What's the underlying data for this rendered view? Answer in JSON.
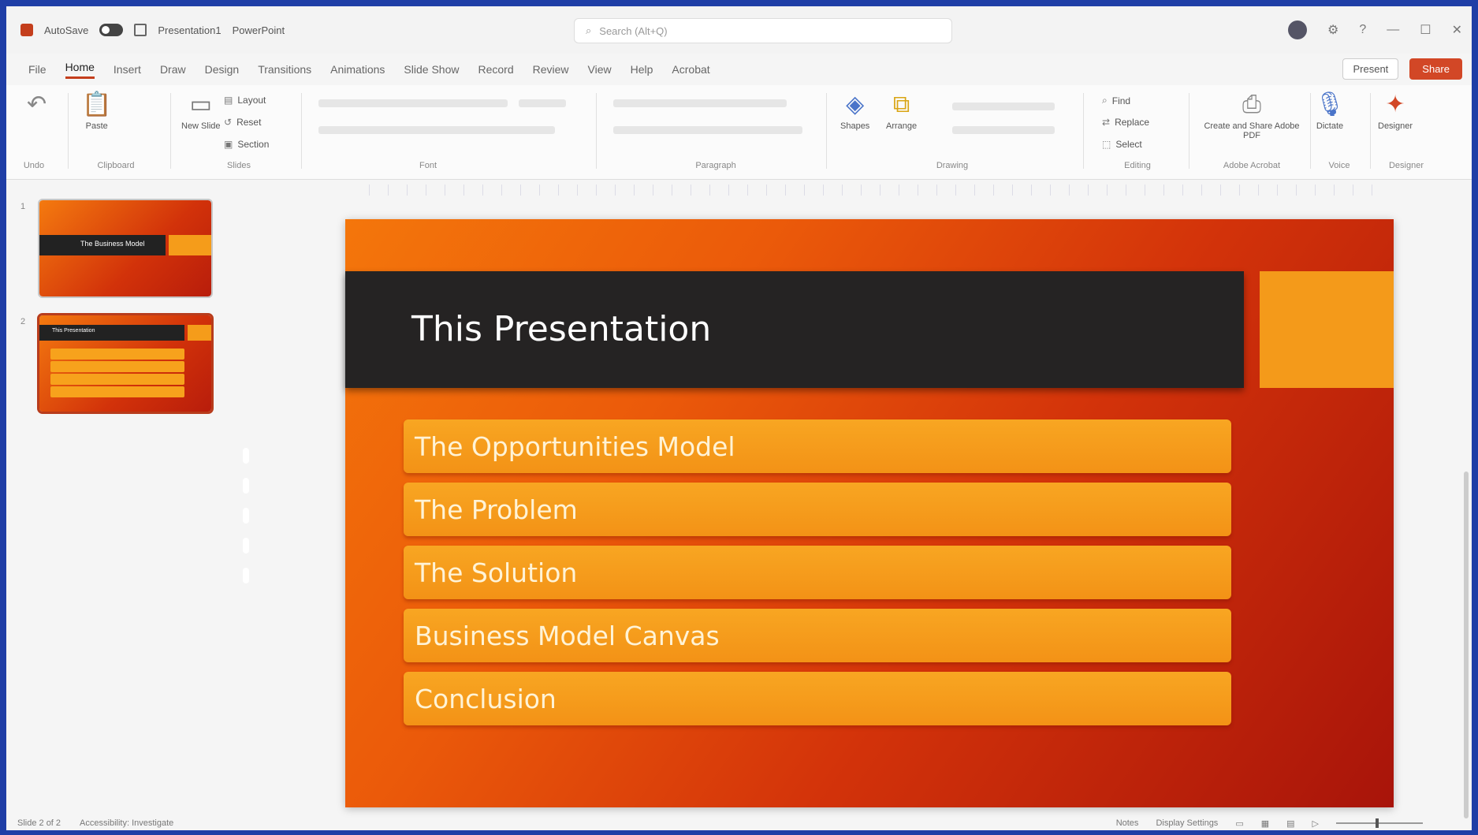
{
  "titlebar": {
    "autosave_label": "AutoSave",
    "file_name": "Presentation1",
    "app_name": "PowerPoint",
    "search_placeholder": "Search (Alt+Q)",
    "user_name": "",
    "glyphs": {
      "settings": "⚙",
      "help": "?",
      "minimize": "—",
      "maximize": "☐",
      "close": "✕"
    }
  },
  "ribbon_tabs": [
    "File",
    "Home",
    "Insert",
    "Draw",
    "Design",
    "Transitions",
    "Animations",
    "Slide Show",
    "Record",
    "Review",
    "View",
    "Help",
    "Acrobat"
  ],
  "ribbon_actions": {
    "present_label": "Present",
    "share_label": "Share"
  },
  "ribbon": {
    "groups": [
      "Undo",
      "Clipboard",
      "Slides",
      "Font",
      "Paragraph",
      "Drawing",
      "Editing",
      "Adobe Acrobat",
      "Voice",
      "Designer"
    ],
    "paste_label": "Paste",
    "new_slide_label": "New Slide",
    "layout_label": "Layout",
    "reset_label": "Reset",
    "section_label": "Section",
    "shapes_label": "Shapes",
    "arrange_label": "Arrange",
    "find_label": "Find",
    "replace_label": "Replace",
    "select_label": "Select",
    "acrobat_label": "Create and Share Adobe PDF",
    "dictate_label": "Dictate",
    "designer_label": "Designer"
  },
  "thumbnails": [
    {
      "number": "1",
      "title": "The Business Model"
    },
    {
      "number": "2",
      "title": "This Presentation"
    }
  ],
  "slide": {
    "title": "This Presentation",
    "items": [
      "The Opportunities Model",
      "The Problem",
      "The Solution",
      "Business Model Canvas",
      "Conclusion"
    ],
    "colors": {
      "title_band": "#252323",
      "item_fill": "#f49a1a",
      "background_start": "#f4760b",
      "background_end": "#a8140a"
    }
  },
  "statusbar": {
    "slide_info": "Slide 2 of 2",
    "accessibility": "Accessibility: Investigate",
    "notes_label": "Notes",
    "display_settings": "Display Settings",
    "zoom": ""
  }
}
